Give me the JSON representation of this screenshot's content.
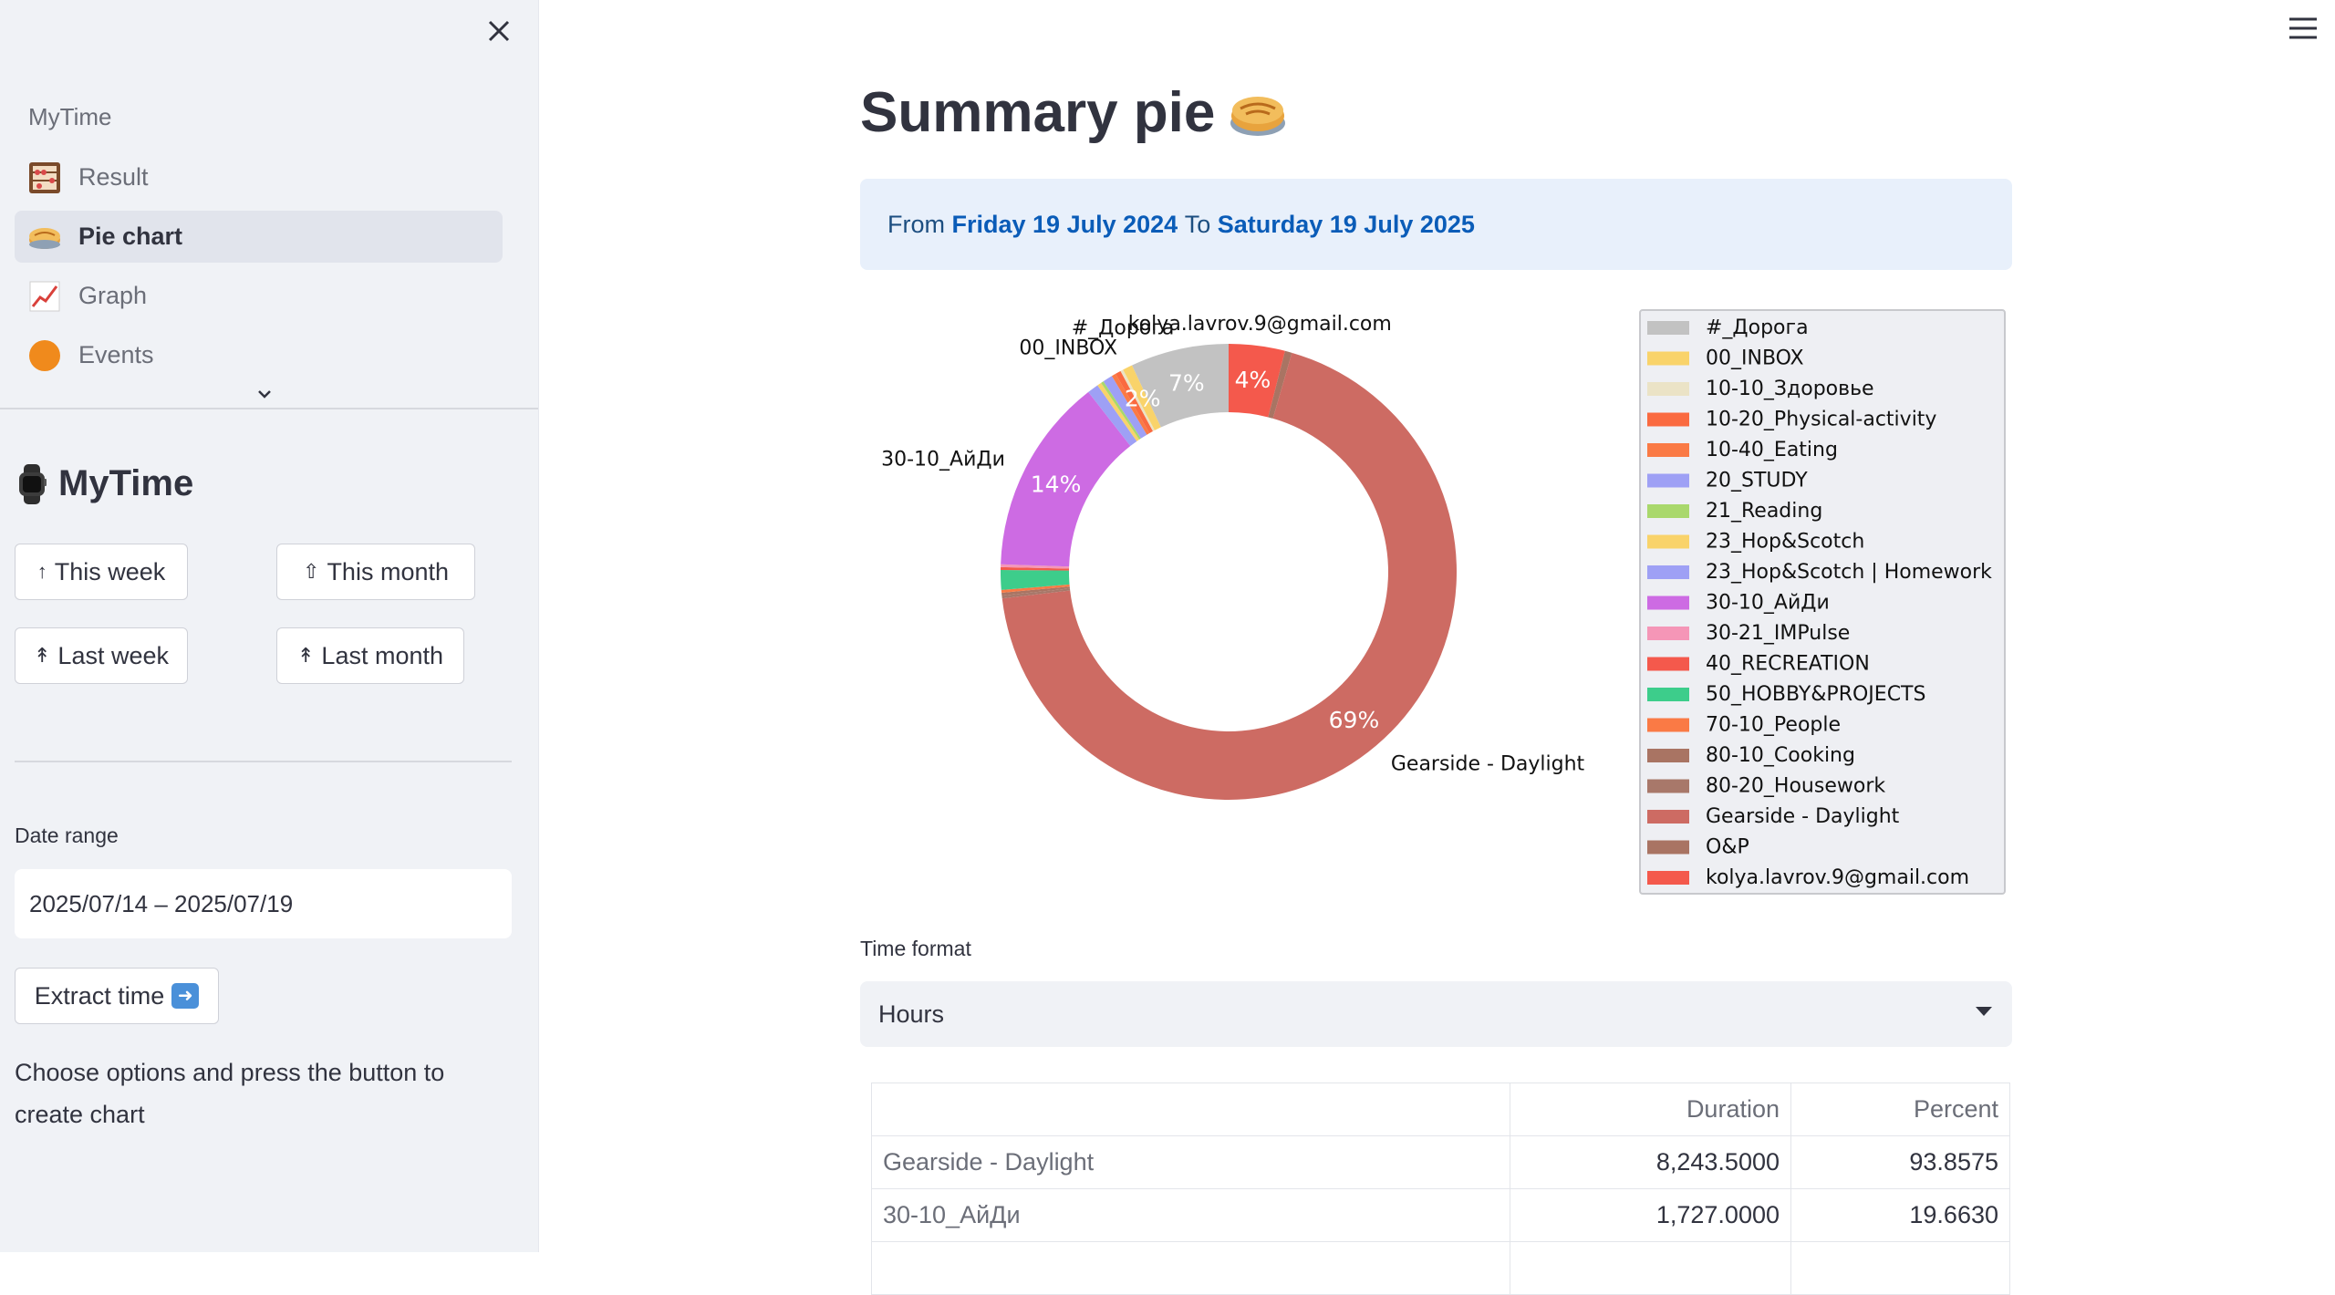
{
  "sidebar": {
    "nav_header": "MyTime",
    "nav_items": [
      {
        "label": "Result",
        "icon": "abacus-icon"
      },
      {
        "label": "Pie chart",
        "icon": "pie-icon",
        "active": true
      },
      {
        "label": "Graph",
        "icon": "chart-up-icon"
      },
      {
        "label": "Events",
        "icon": "orange-circle-icon"
      }
    ],
    "title": "MyTime",
    "buttons": {
      "this_week": "This week",
      "this_month": "This month",
      "last_week": "Last week",
      "last_month": "Last month"
    },
    "date_range_label": "Date range",
    "date_range_value": "2025/07/14 – 2025/07/19",
    "extract_label": "Extract time",
    "help_text": "Choose options and press the button to create chart"
  },
  "main": {
    "title": "Summary pie",
    "info": {
      "from_word": "From",
      "from_date": "Friday 19 July 2024",
      "to_word": "To",
      "to_date": "Saturday 19 July 2025"
    },
    "time_format_label": "Time format",
    "time_format_value": "Hours",
    "table": {
      "headers": [
        "",
        "Duration",
        "Percent"
      ],
      "rows": [
        {
          "name": "Gearside - Daylight",
          "duration": "8,243.5000",
          "percent": "93.8575"
        },
        {
          "name": "30-10_АйДи",
          "duration": "1,727.0000",
          "percent": "19.6630"
        }
      ]
    }
  },
  "chart_data": {
    "type": "pie",
    "donut": true,
    "legend_position": "right",
    "slices": [
      {
        "label": "kolya.lavrov.9@gmail.com",
        "value": 4.0,
        "color": "#f4594c",
        "pct_label": "4%",
        "outer_label": "kolya.lavrov.9@gmail.com"
      },
      {
        "label": "O&P",
        "value": 0.5,
        "color": "#a97463"
      },
      {
        "label": "Gearside - Daylight",
        "value": 69.0,
        "color": "#cd6b63",
        "pct_label": "69%",
        "outer_label": "Gearside - Daylight"
      },
      {
        "label": "80-20_Housework",
        "value": 0.2,
        "color": "#a8786a"
      },
      {
        "label": "80-10_Cooking",
        "value": 0.2,
        "color": "#a97463"
      },
      {
        "label": "70-10_People",
        "value": 0.2,
        "color": "#fa7a45"
      },
      {
        "label": "50_HOBBY&PROJECTS",
        "value": 1.4,
        "color": "#3dcd8b"
      },
      {
        "label": "40_RECREATION",
        "value": 0.2,
        "color": "#f4594c"
      },
      {
        "label": "30-21_IMPulse",
        "value": 0.2,
        "color": "#f596b7"
      },
      {
        "label": "30-10_АйДи",
        "value": 14.0,
        "color": "#cd6be3",
        "pct_label": "14%",
        "outer_label": "30-10_АйДи"
      },
      {
        "label": "23_Hop&Scotch | Homework",
        "value": 0.8,
        "color": "#9ea0f5"
      },
      {
        "label": "23_Hop&Scotch",
        "value": 0.3,
        "color": "#f9d36a"
      },
      {
        "label": "21_Reading",
        "value": 0.2,
        "color": "#a9d86c"
      },
      {
        "label": "20_STUDY",
        "value": 0.7,
        "color": "#9ea0f5"
      },
      {
        "label": "10-40_Eating",
        "value": 0.3,
        "color": "#fa7a45"
      },
      {
        "label": "10-20_Physical-activity",
        "value": 0.4,
        "color": "#fa6a40"
      },
      {
        "label": "10-10_Здоровье",
        "value": 0.2,
        "color": "#ebe3c6"
      },
      {
        "label": "00_INBOX",
        "value": 0.7,
        "color": "#f9d36a",
        "pct_label": "2%",
        "outer_label": "00_INBOX"
      },
      {
        "label": "#_Дорога",
        "value": 7.0,
        "color": "#c2c2c2",
        "pct_label": "7%",
        "outer_label": "#_Дорога"
      }
    ],
    "legend": [
      {
        "label": "#_Дорога",
        "color": "#c2c2c2"
      },
      {
        "label": "00_INBOX",
        "color": "#f9d36a"
      },
      {
        "label": "10-10_Здоровье",
        "color": "#ebe3c6"
      },
      {
        "label": "10-20_Physical-activity",
        "color": "#fa6a40"
      },
      {
        "label": "10-40_Eating",
        "color": "#fa7a45"
      },
      {
        "label": "20_STUDY",
        "color": "#9ea0f5"
      },
      {
        "label": "21_Reading",
        "color": "#a9d86c"
      },
      {
        "label": "23_Hop&Scotch",
        "color": "#f9d36a"
      },
      {
        "label": "23_Hop&Scotch | Homework",
        "color": "#9ea0f5"
      },
      {
        "label": "30-10_АйДи",
        "color": "#cd6be3"
      },
      {
        "label": "30-21_IMPulse",
        "color": "#f596b7"
      },
      {
        "label": "40_RECREATION",
        "color": "#f4594c"
      },
      {
        "label": "50_HOBBY&PROJECTS",
        "color": "#3dcd8b"
      },
      {
        "label": "70-10_People",
        "color": "#fa7a45"
      },
      {
        "label": "80-10_Cooking",
        "color": "#a97463"
      },
      {
        "label": "80-20_Housework",
        "color": "#a8786a"
      },
      {
        "label": "Gearside - Daylight",
        "color": "#cd6b63"
      },
      {
        "label": "O&P",
        "color": "#a97463"
      },
      {
        "label": "kolya.lavrov.9@gmail.com",
        "color": "#f4594c"
      }
    ]
  }
}
